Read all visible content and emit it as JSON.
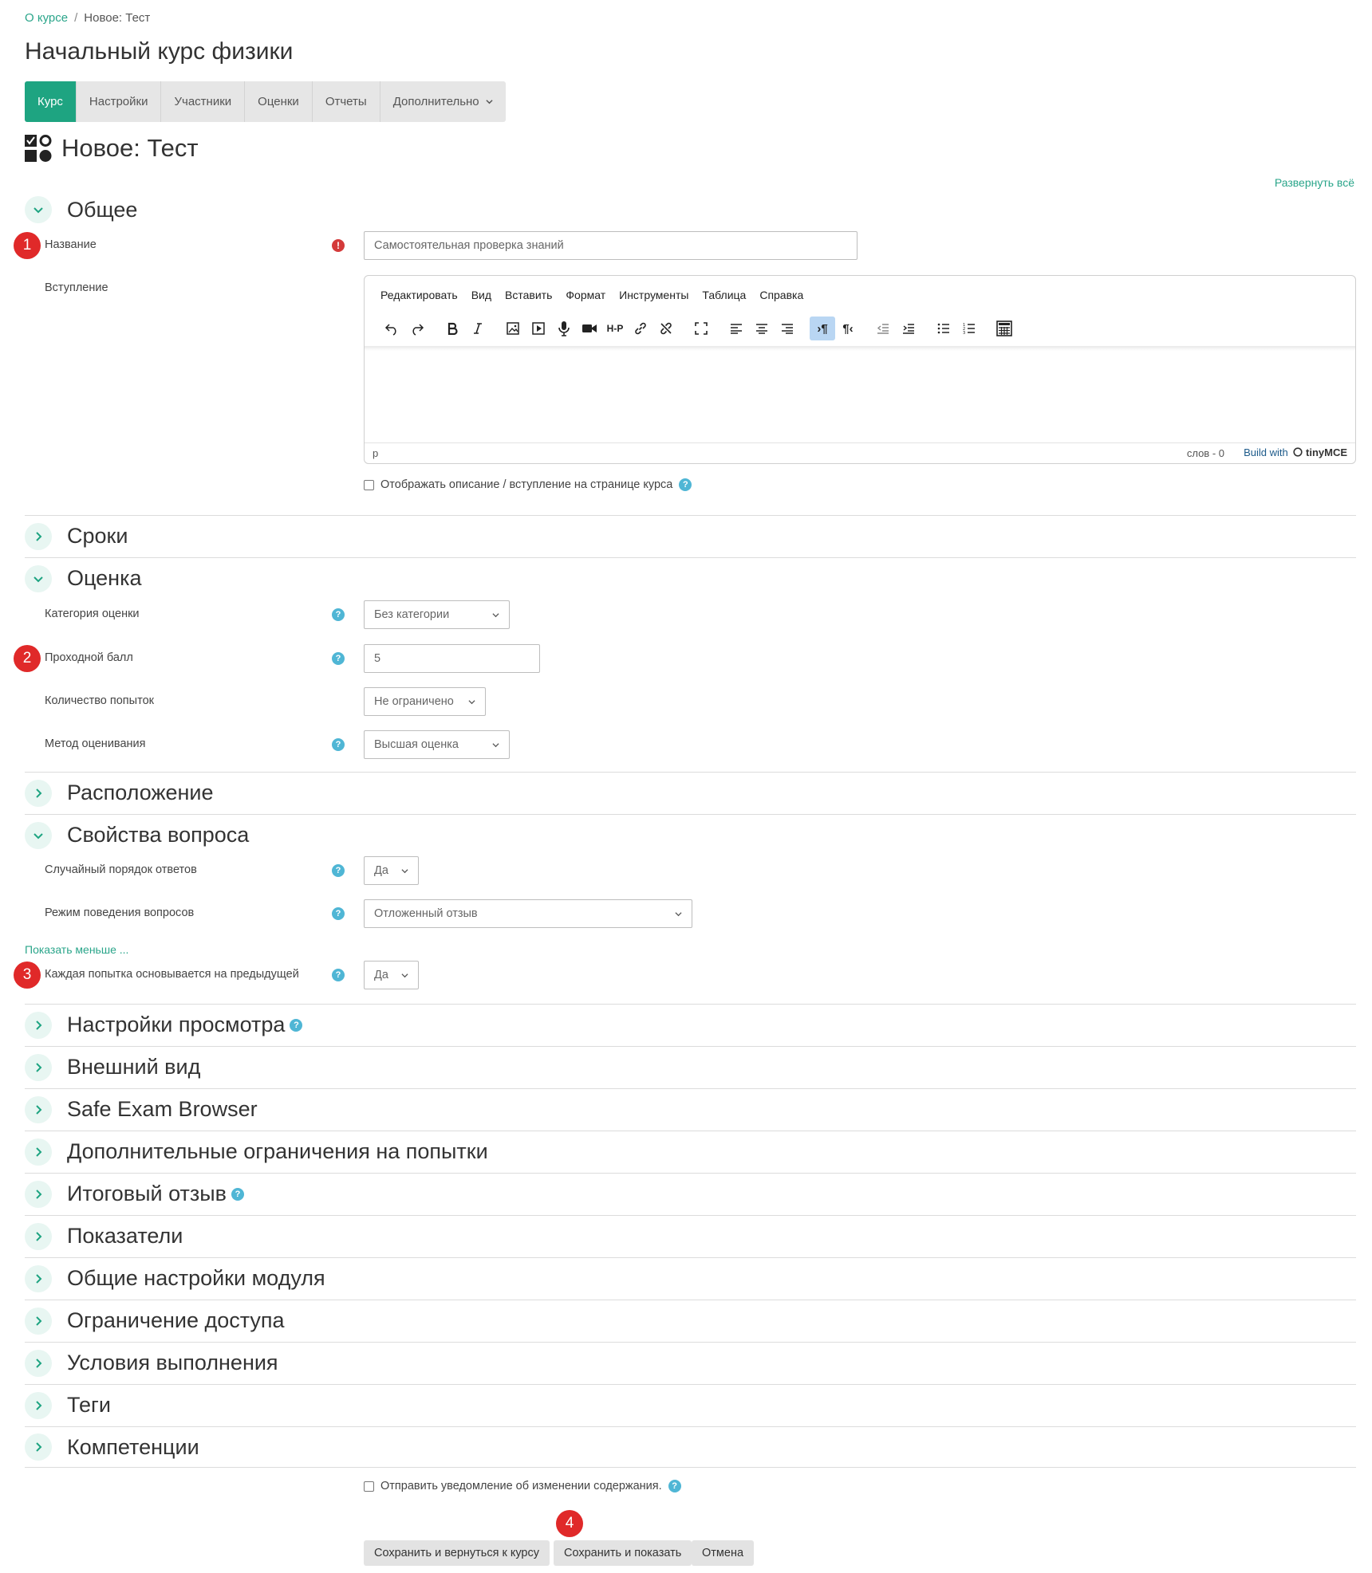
{
  "breadcrumb": {
    "item1": "О курсе",
    "separator": "/",
    "item2": "Новое: Тест"
  },
  "course_title": "Начальный курс физики",
  "tabs": [
    {
      "label": "Курс",
      "active": true
    },
    {
      "label": "Настройки"
    },
    {
      "label": "Участники"
    },
    {
      "label": "Оценки"
    },
    {
      "label": "Отчеты"
    },
    {
      "label": "Дополнительно"
    }
  ],
  "page_heading": "Новое: Тест",
  "expand_all": "Развернуть всё",
  "general": {
    "title": "Общее",
    "name_label": "Название",
    "name_value": "Самостоятельная проверка знаний",
    "intro_label": "Вступление",
    "editor": {
      "menu": [
        "Редактировать",
        "Вид",
        "Вставить",
        "Формат",
        "Инструменты",
        "Таблица",
        "Справка"
      ],
      "path": "p",
      "word_count": "слов - 0",
      "brand_prefix": "Build with",
      "brand_name": "tinyMCE"
    },
    "show_desc_label": "Отображать описание / вступление на странице курса"
  },
  "timing": {
    "title": "Сроки"
  },
  "grade": {
    "title": "Оценка",
    "category_label": "Категория оценки",
    "category_value": "Без категории",
    "pass_label": "Проходной балл",
    "pass_value": "5",
    "attempts_label": "Количество попыток",
    "attempts_value": "Не ограничено",
    "method_label": "Метод оценивания",
    "method_value": "Высшая оценка"
  },
  "layout": {
    "title": "Расположение"
  },
  "question_behaviour": {
    "title": "Свойства вопроса",
    "shuffle_label": "Случайный порядок ответов",
    "shuffle_value": "Да",
    "mode_label": "Режим поведения вопросов",
    "mode_value": "Отложенный отзыв",
    "show_less": "Показать меньше ...",
    "each_attempt_label": "Каждая попытка основывается на предыдущей",
    "each_attempt_value": "Да"
  },
  "sections": [
    {
      "title": "Настройки просмотра",
      "help": true
    },
    {
      "title": "Внешний вид"
    },
    {
      "title": "Safe Exam Browser"
    },
    {
      "title": "Дополнительные ограничения на попытки"
    },
    {
      "title": "Итоговый отзыв",
      "help": true
    },
    {
      "title": "Показатели"
    },
    {
      "title": "Общие настройки модуля"
    },
    {
      "title": "Ограничение доступа"
    },
    {
      "title": "Условия выполнения"
    },
    {
      "title": "Теги"
    },
    {
      "title": "Компетенции"
    }
  ],
  "notify_label": "Отправить уведомление об изменении содержания.",
  "buttons": {
    "save_return": "Сохранить и вернуться к курсу",
    "save_display": "Сохранить и показать",
    "cancel": "Отмена"
  },
  "markers": [
    "1",
    "2",
    "3",
    "4"
  ],
  "help_glyph": "?",
  "required_glyph": "!",
  "colors": {
    "accent": "#1ea481",
    "marker": "#e02929",
    "help": "#4fb6d5"
  }
}
